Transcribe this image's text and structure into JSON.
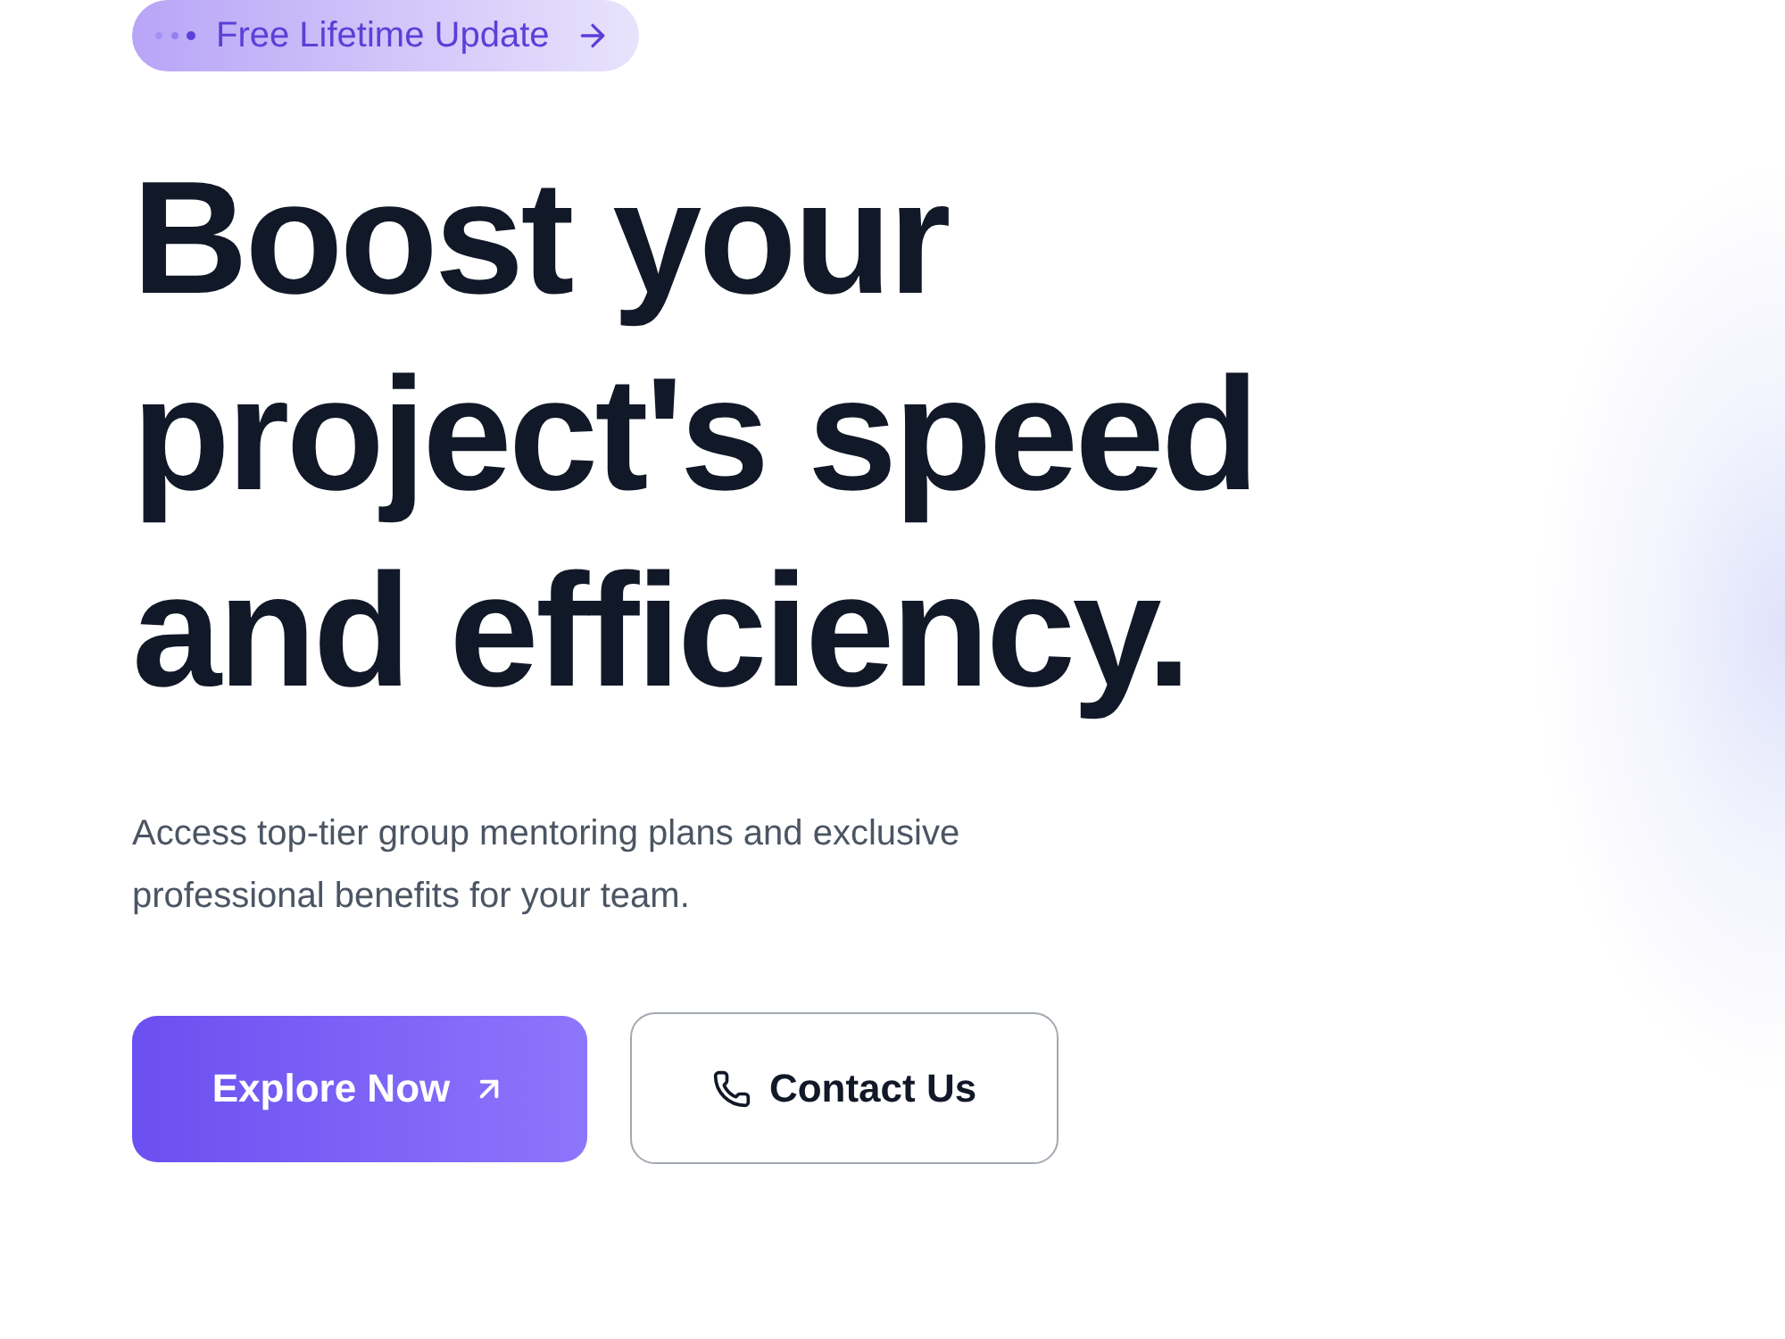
{
  "badge": {
    "text": "Free Lifetime Update"
  },
  "heading": "Boost your project's speed and efficiency.",
  "description": "Access top-tier group mentoring plans and exclusive professional benefits for your team.",
  "buttons": [
    {
      "label": "Explore Now",
      "kind": "primary"
    },
    {
      "label": "Contact Us",
      "kind": "secondary"
    }
  ]
}
